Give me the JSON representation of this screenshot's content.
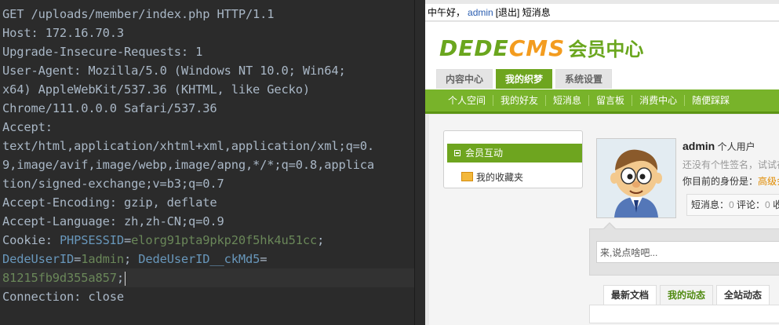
{
  "request": {
    "lines": [
      {
        "key": "GET /uploads/member/index.php HTTP/1.1",
        "val": ""
      },
      {
        "key": "Host: ",
        "val": "172.16.70.3"
      },
      {
        "key": "Upgrade-Insecure-Requests: ",
        "val": "1"
      },
      {
        "key": "User-Agent: ",
        "val": "Mozilla/5.0 (Windows NT 10.0; Win64;"
      },
      {
        "key": "",
        "val": "x64) AppleWebKit/537.36 (KHTML, like Gecko)"
      },
      {
        "key": "",
        "val": "Chrome/111.0.0.0 Safari/537.36"
      },
      {
        "key": "Accept:",
        "val": ""
      },
      {
        "key": "",
        "val": "text/html,application/xhtml+xml,application/xml;q=0."
      },
      {
        "key": "",
        "val": "9,image/avif,image/webp,image/apng,*/*;q=0.8,applica"
      },
      {
        "key": "",
        "val": "tion/signed-exchange;v=b3;q=0.7"
      },
      {
        "key": "Accept-Encoding: ",
        "val": "gzip, deflate"
      },
      {
        "key": "Accept-Language: ",
        "val": "zh,zh-CN;q=0.9"
      }
    ],
    "cookie": {
      "label": "Cookie: ",
      "c1_name": "PHPSESSID",
      "c1_eq": "=",
      "c1_value": "elorg91pta9pkp20f5hk4u51cc",
      "c1_sep": ";",
      "c2_name": "DedeUserID",
      "c2_eq": "=",
      "c2_value": "1admin",
      "c2_sep": "; ",
      "c3_name": "DedeUserID__ckMd5",
      "c3_eq": "=",
      "c3_value": "81215fb9d355a857",
      "c3_sep": ";"
    },
    "connection_key": "Connection: ",
    "connection_val": "close",
    "colors": {
      "bg": "#2b2b2b",
      "text": "#a9b7c6",
      "cookie_name": "#6897bb",
      "cookie_value": "#6a8759"
    }
  },
  "site": {
    "topbar": {
      "greeting": "中午好，",
      "user": "admin",
      "logout": "[退出]",
      "messages": "短消息"
    },
    "logo": {
      "part1": "DEDE",
      "part2": "CMS",
      "part3": "会员中心"
    },
    "tabs": [
      "内容中心",
      "我的织梦",
      "系统设置"
    ],
    "active_tab": "我的织梦",
    "nav": [
      "个人空间",
      "我的好友",
      "短消息",
      "留言板",
      "消费中心",
      "随便踩踩"
    ],
    "sidebar": {
      "current": "会员互动",
      "favorites": "我的收藏夹"
    },
    "profile": {
      "name": "admin",
      "type": "个人用户",
      "signature": "还没有个性签名，试试在",
      "identity_prefix": "你目前的身份是：",
      "identity_value": "高级会",
      "stats_sms_label": "短消息：",
      "stats_sms_value": "0",
      "stats_comment_label": " 评论：",
      "stats_comment_value": "0",
      "stats_more": " 收藏"
    },
    "talk_placeholder": "来,说点啥吧...",
    "subtabs": [
      "最新文档",
      "我的动态",
      "全站动态"
    ],
    "active_subtab": "我的动态",
    "colors": {
      "green": "#6ea51f",
      "orange": "#f39c1f",
      "link": "#2a5db0"
    }
  }
}
